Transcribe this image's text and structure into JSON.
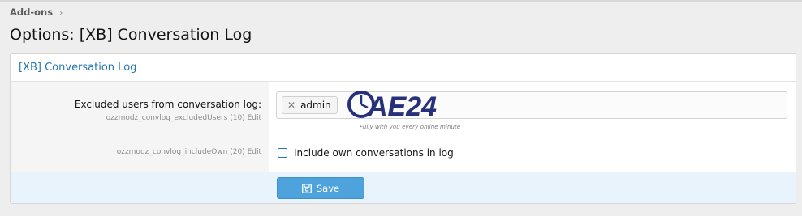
{
  "breadcrumb": {
    "label": "Add-ons",
    "chevron": "›"
  },
  "page": {
    "title": "Options: [XB] Conversation Log"
  },
  "panel": {
    "title": "[XB] Conversation Log",
    "rows": [
      {
        "label": "Excluded users from conversation log:",
        "option_id": "ozzmodz_convlog_excludedUsers (10)",
        "edit_label": "Edit",
        "tokens": [
          "admin"
        ]
      },
      {
        "label": "",
        "option_id": "ozzmodz_convlog_includeOwn (20)",
        "edit_label": "Edit",
        "checkbox_label": "Include own conversations in log",
        "checked": false
      }
    ]
  },
  "watermark": {
    "text": "AE24",
    "tagline": "Fully with you every online minute"
  },
  "footer": {
    "save_label": "Save"
  },
  "colors": {
    "accent": "#2577b1",
    "button": "#4ea3dd",
    "footer_bg": "#e9f3fb"
  }
}
